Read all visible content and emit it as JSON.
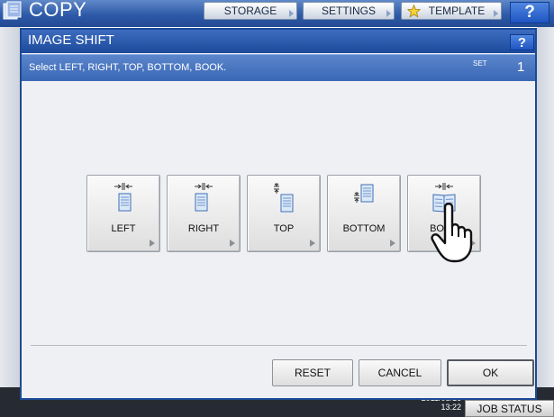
{
  "topbar": {
    "title": "COPY",
    "tabs": [
      {
        "label": "STORAGE"
      },
      {
        "label": "SETTINGS"
      },
      {
        "label": "TEMPLATE"
      }
    ],
    "help_label": "?"
  },
  "dialog": {
    "title": "IMAGE SHIFT",
    "help_label": "?",
    "message": "Select LEFT, RIGHT, TOP, BOTTOM, BOOK.",
    "set_label": "SET",
    "set_count": "1",
    "options": [
      {
        "label": "LEFT",
        "icon": "left-shift-icon"
      },
      {
        "label": "RIGHT",
        "icon": "right-shift-icon"
      },
      {
        "label": "TOP",
        "icon": "top-shift-icon"
      },
      {
        "label": "BOTTOM",
        "icon": "bottom-shift-icon"
      },
      {
        "label": "BOOK",
        "icon": "book-shift-icon"
      }
    ],
    "footer": {
      "reset_label": "RESET",
      "cancel_label": "CANCEL",
      "ok_label": "OK"
    }
  },
  "status": {
    "date": "2011/08/16",
    "time": "13:22",
    "job_status_label": "JOB STATUS"
  },
  "colors": {
    "header_blue": "#1d4a9a",
    "message_blue": "#3a67b5",
    "dialog_bg": "#eef0f3"
  }
}
